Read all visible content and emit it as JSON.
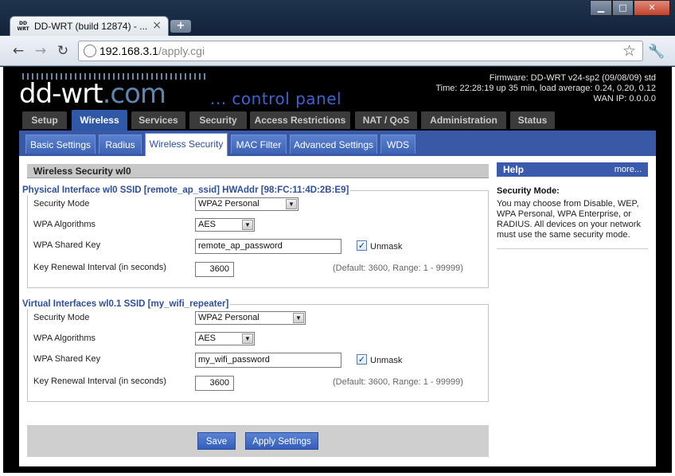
{
  "browser": {
    "tab_title": "DD-WRT (build 12874) - ...",
    "tab_icon_text": "DD WRT",
    "tab_close": "×",
    "new_tab": "+",
    "url_host": "192.168.3.1",
    "url_path": "/apply.cgi",
    "back": "←",
    "forward": "→",
    "reload": "↻",
    "star": "☆",
    "wrench": "🔧",
    "win_min": "▁",
    "win_max": "□",
    "win_close": "✕"
  },
  "header": {
    "logo_main": "dd-wrt",
    "logo_com": ".com",
    "control_panel": "... control panel",
    "firmware": "Firmware: DD-WRT v24-sp2 (09/08/09) std",
    "time": "Time: 22:28:19 up 35 min, load average: 0.24, 0.20, 0.12",
    "wan_ip": "WAN IP: 0.0.0.0"
  },
  "main_tabs": [
    "Setup",
    "Wireless",
    "Services",
    "Security",
    "Access Restrictions",
    "NAT / QoS",
    "Administration",
    "Status"
  ],
  "sub_tabs": [
    "Basic Settings",
    "Radius",
    "Wireless Security",
    "MAC Filter",
    "Advanced Settings",
    "WDS"
  ],
  "section_title": "Wireless Security wl0",
  "physical": {
    "legend": "Physical Interface wl0 SSID [remote_ap_ssid] HWAddr [98:FC:11:4D:2B:E9]",
    "security_mode_label": "Security Mode",
    "security_mode_value": "WPA2 Personal",
    "wpa_alg_label": "WPA Algorithms",
    "wpa_alg_value": "AES",
    "shared_key_label": "WPA Shared Key",
    "shared_key_value": "remote_ap_password",
    "unmask_label": "Unmask",
    "unmask_checked": "✓",
    "renewal_label": "Key Renewal Interval (in seconds)",
    "renewal_value": "3600",
    "renewal_hint": "(Default: 3600, Range: 1 - 99999)"
  },
  "virtual": {
    "legend": "Virtual Interfaces wl0.1 SSID [my_wifi_repeater]",
    "security_mode_label": "Security Mode",
    "security_mode_value": "WPA2 Personal",
    "wpa_alg_label": "WPA Algorithms",
    "wpa_alg_value": "AES",
    "shared_key_label": "WPA Shared Key",
    "shared_key_value": "my_wifi_password",
    "unmask_label": "Unmask",
    "unmask_checked": "✓",
    "renewal_label": "Key Renewal Interval (in seconds)",
    "renewal_value": "3600",
    "renewal_hint": "(Default: 3600, Range: 1 - 99999)"
  },
  "buttons": {
    "save": "Save",
    "apply": "Apply Settings"
  },
  "help": {
    "title": "Help",
    "more": "more...",
    "subtitle": "Security Mode:",
    "text": "You may choose from Disable, WEP, WPA Personal, WPA Enterprise, or RADIUS. All devices on your network must use the same security mode."
  },
  "colors": {
    "accent": "#3a5bad",
    "active_tab": "#2f58a7",
    "legend": "#2f4f9a"
  }
}
